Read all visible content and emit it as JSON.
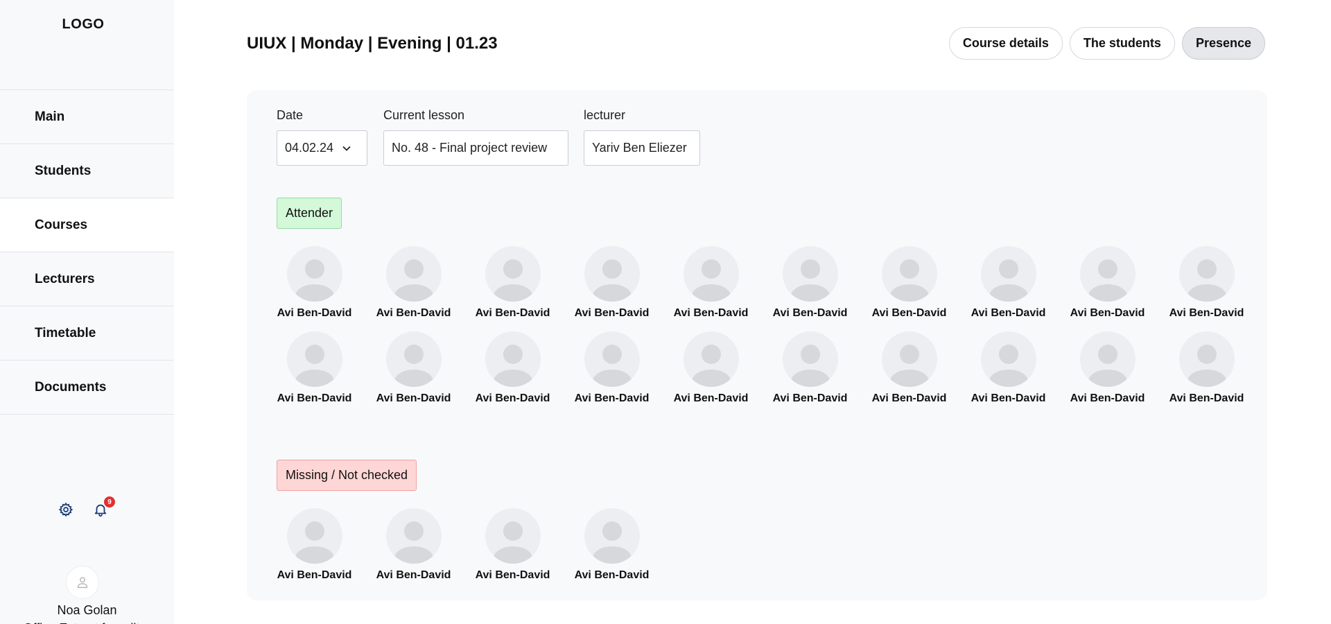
{
  "sidebar": {
    "logo": "LOGO",
    "items": [
      {
        "label": "Main"
      },
      {
        "label": "Students"
      },
      {
        "label": "Courses"
      },
      {
        "label": "Lecturers"
      },
      {
        "label": "Timetable"
      },
      {
        "label": "Documents"
      }
    ],
    "active_item": "Courses",
    "notification_count": "9",
    "user": {
      "name": "Noa Golan",
      "role": "Office Extract for editor"
    }
  },
  "header": {
    "title": "UIUX | Monday | Evening | 01.23",
    "tabs": [
      {
        "label": "Course details"
      },
      {
        "label": "The students"
      },
      {
        "label": "Presence"
      }
    ],
    "active_tab": "Presence"
  },
  "filters": {
    "date": {
      "label": "Date",
      "value": "04.02.24"
    },
    "lesson": {
      "label": "Current lesson",
      "value": "No. 48 - Final project review"
    },
    "lecturer": {
      "label": "lecturer",
      "value": "Yariv Ben Eliezer"
    }
  },
  "attender": {
    "label": "Attender",
    "students": [
      "Avi Ben-David",
      "Avi Ben-David",
      "Avi Ben-David",
      "Avi Ben-David",
      "Avi Ben-David",
      "Avi Ben-David",
      "Avi Ben-David",
      "Avi Ben-David",
      "Avi Ben-David",
      "Avi Ben-David",
      "Avi Ben-David",
      "Avi Ben-David",
      "Avi Ben-David",
      "Avi Ben-David",
      "Avi Ben-David",
      "Avi Ben-David",
      "Avi Ben-David",
      "Avi Ben-David",
      "Avi Ben-David",
      "Avi Ben-David"
    ]
  },
  "missing": {
    "label": "Missing / Not checked",
    "students": [
      "Avi Ben-David",
      "Avi Ben-David",
      "Avi Ben-David",
      "Avi Ben-David"
    ]
  },
  "colors": {
    "attender_bg": "#d3f9d8",
    "missing_bg": "#ffd6d6",
    "badge": "#e03131"
  },
  "icons": {
    "settings": "gear-icon",
    "notifications": "bell-icon",
    "date_dropdown": "chevron-down-icon",
    "avatar": "user-icon"
  }
}
